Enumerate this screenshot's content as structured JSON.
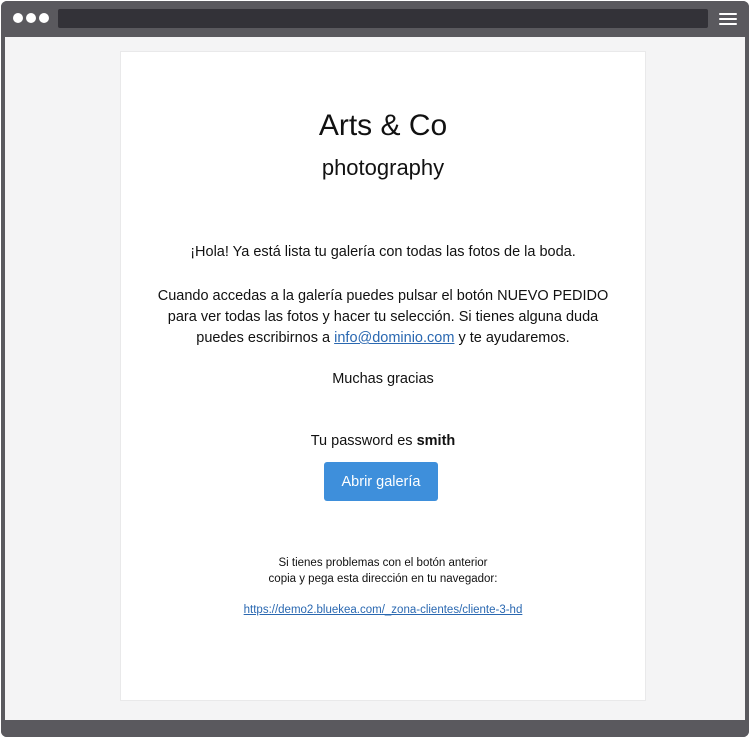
{
  "brand": {
    "title": "Arts & Co",
    "subtitle": "photography"
  },
  "message": {
    "greeting": "¡Hola! Ya está lista tu galería con todas las fotos de la boda.",
    "body_line1": "Cuando accedas a la galería puedes pulsar el botón NUEVO PEDIDO",
    "body_line2": "para ver todas las fotos y hacer tu selección. Si tienes alguna duda",
    "body_line3_prefix": "puedes escribirnos a",
    "email": "info@dominio.com",
    "body_line3_suffix": "y te ayudaremos.",
    "thanks": "Muchas gracias"
  },
  "password": {
    "label": "Tu password es",
    "value": "smith"
  },
  "button": {
    "label": "Abrir galería"
  },
  "fallback": {
    "line1": "Si tienes problemas con el botón anterior",
    "line2": "copia y pega esta dirección en tu navegador:",
    "url": "https://demo2.bluekea.com/_zona-clientes/cliente-3-hd"
  }
}
